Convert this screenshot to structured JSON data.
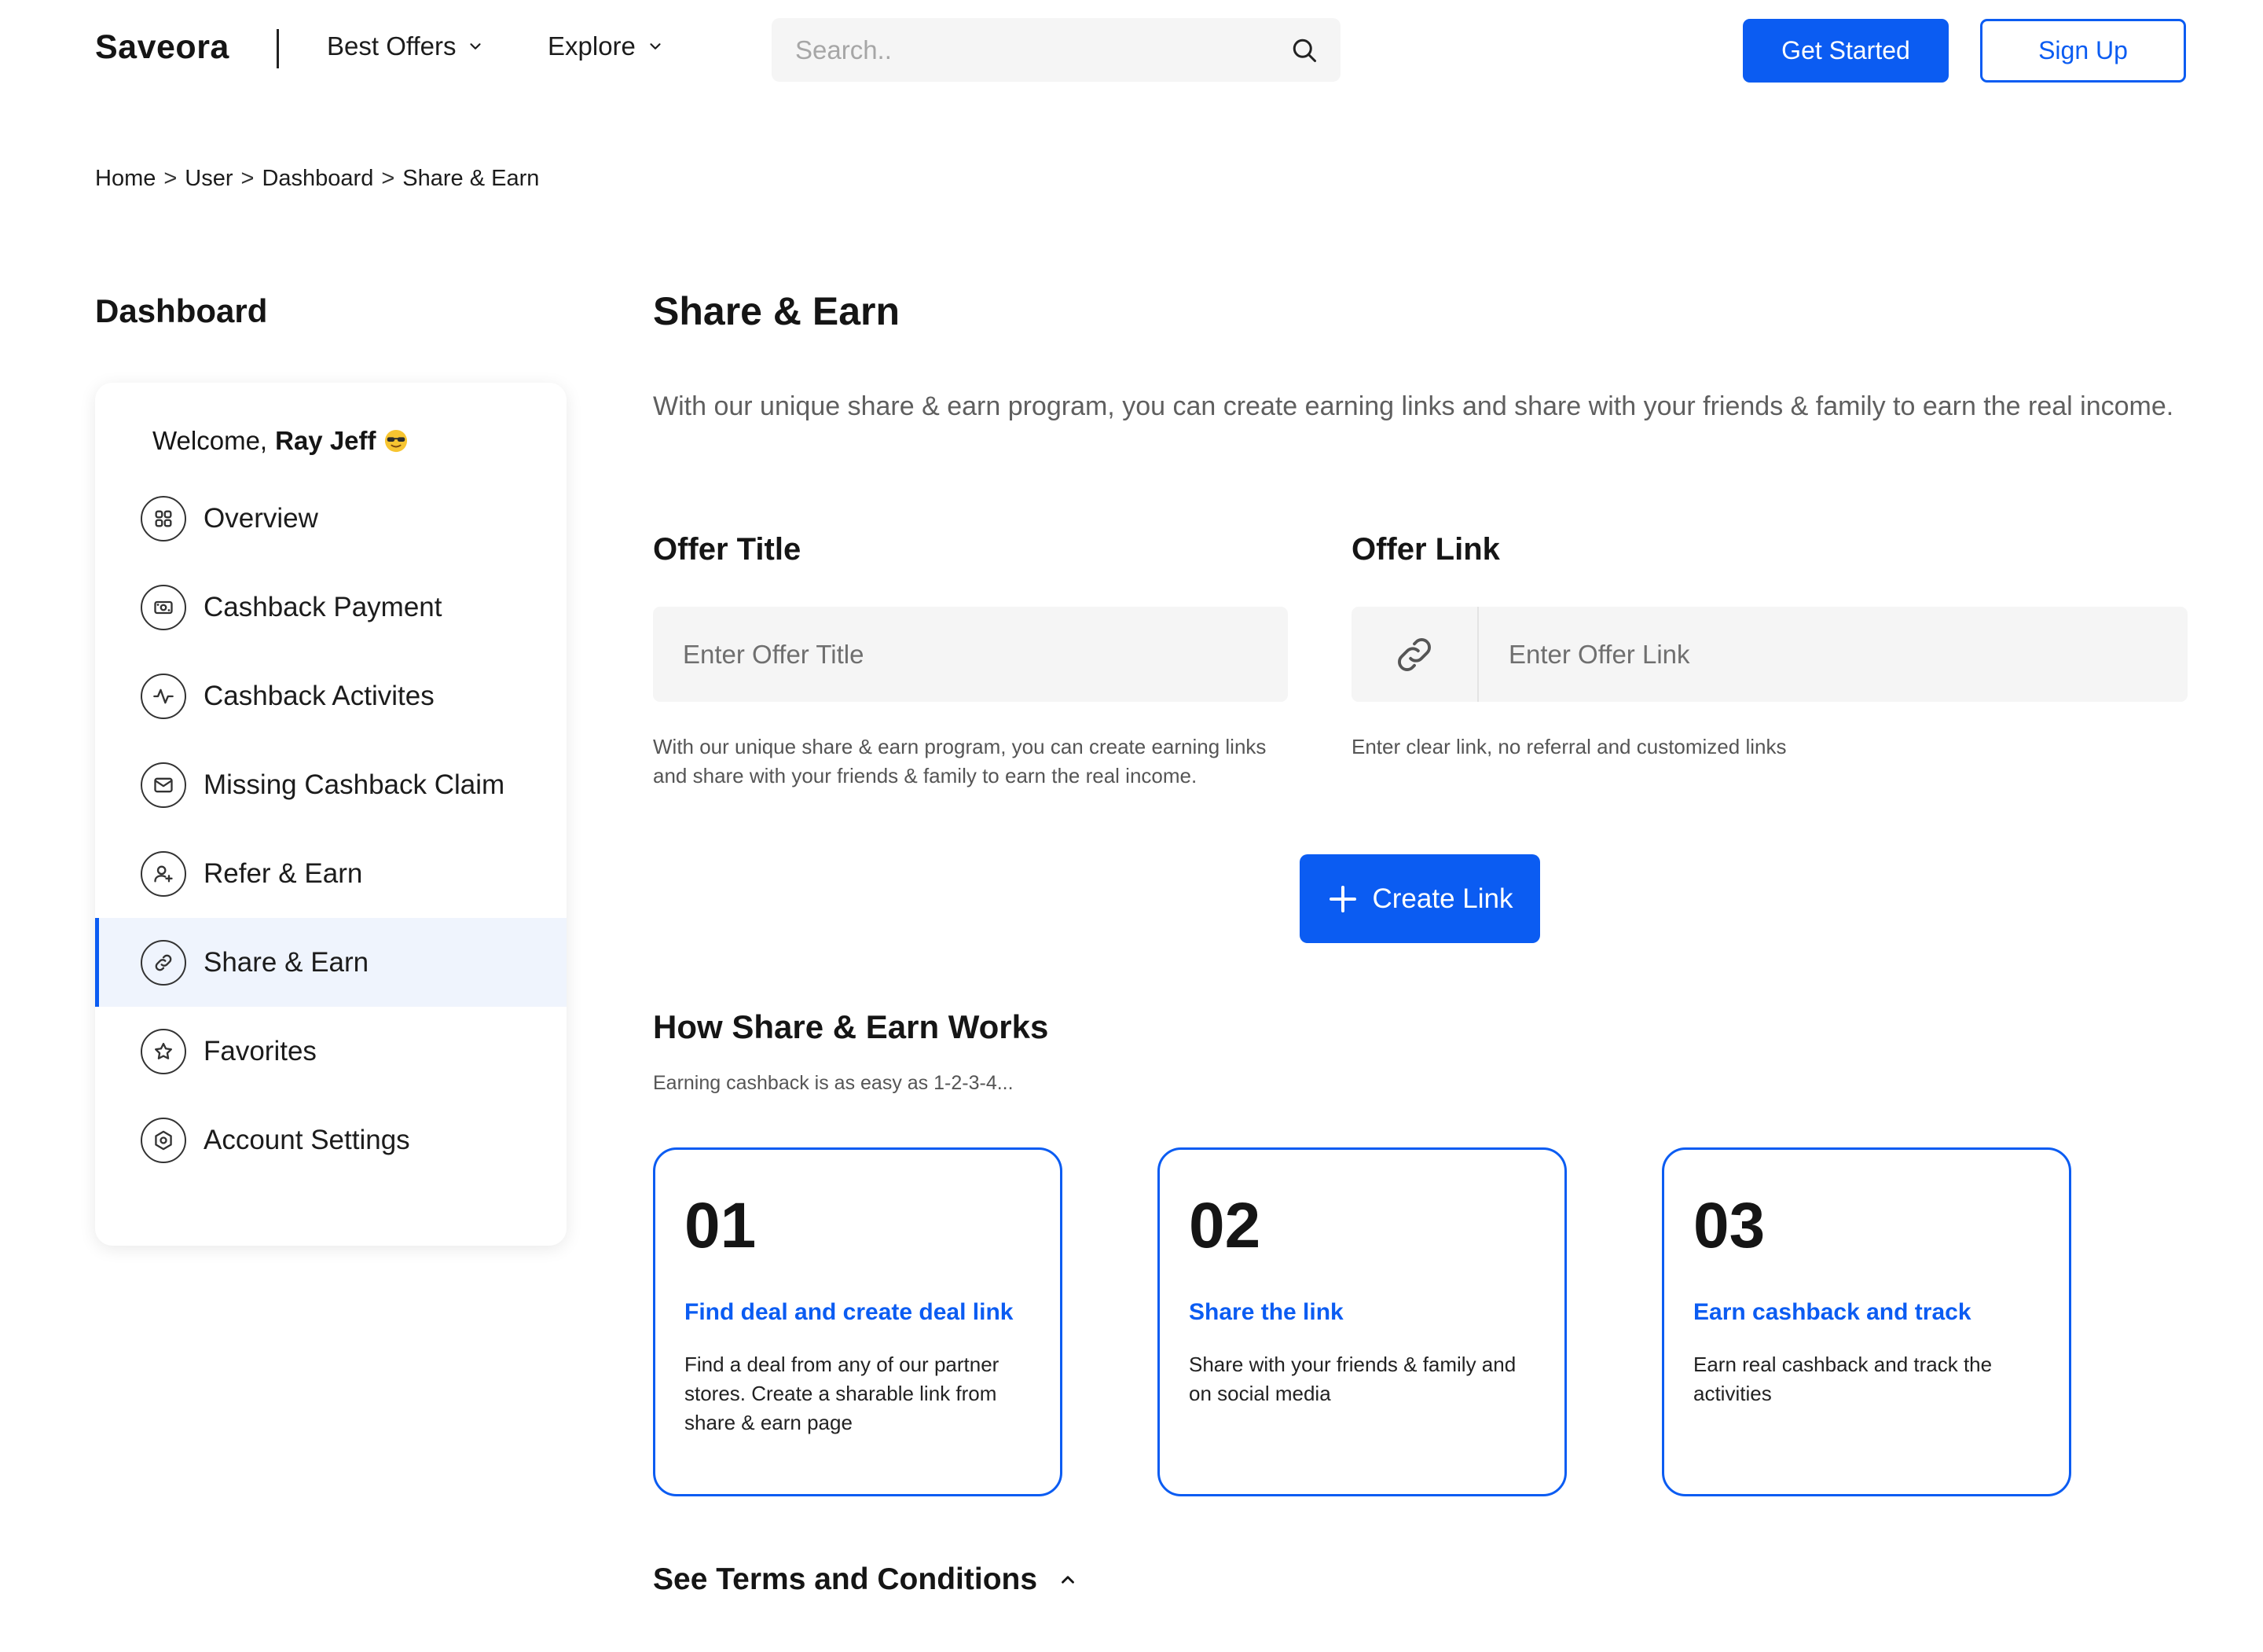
{
  "header": {
    "logo": "Saveora",
    "nav": [
      {
        "label": "Best Offers"
      },
      {
        "label": "Explore"
      }
    ],
    "search_placeholder": "Search..",
    "get_started": "Get Started",
    "sign_up": "Sign Up"
  },
  "breadcrumb": [
    "Home",
    "User",
    "Dashboard",
    "Share & Earn"
  ],
  "breadcrumb_sep": ">",
  "sidebar": {
    "title": "Dashboard",
    "welcome_prefix": "Welcome,",
    "user_name": "Ray Jeff",
    "items": [
      {
        "label": "Overview",
        "icon": "grid-icon"
      },
      {
        "label": "Cashback Payment",
        "icon": "cash-icon"
      },
      {
        "label": "Cashback Activites",
        "icon": "activity-icon"
      },
      {
        "label": "Missing Cashback Claim",
        "icon": "mail-icon"
      },
      {
        "label": "Refer & Earn",
        "icon": "user-plus-icon"
      },
      {
        "label": "Share & Earn",
        "icon": "link-icon"
      },
      {
        "label": "Favorites",
        "icon": "star-icon"
      },
      {
        "label": "Account Settings",
        "icon": "gear-icon"
      }
    ],
    "active_index": 5
  },
  "main": {
    "title": "Share & Earn",
    "intro": "With our unique share & earn program, you can create earning links and share with your friends & family to earn the real income.",
    "offer_title_label": "Offer Title",
    "offer_title_placeholder": "Enter Offer Title",
    "offer_title_help": "With our unique share & earn program, you can create earning links and share with your friends & family to earn the real income.",
    "offer_link_label": "Offer Link",
    "offer_link_placeholder": "Enter Offer Link",
    "offer_link_help": "Enter clear link, no referral and customized links",
    "create_button": "Create Link",
    "how_title": "How Share & Earn Works",
    "how_subtitle": "Earning cashback is as easy as 1-2-3-4...",
    "steps": [
      {
        "num": "01",
        "heading": "Find deal and create deal link",
        "text": "Find a deal from any of our partner stores. Create a sharable link from share & earn page"
      },
      {
        "num": "02",
        "heading": "Share the link",
        "text": "Share with your friends & family and on social media"
      },
      {
        "num": "03",
        "heading": "Earn cashback and track",
        "text": "Earn real cashback and track the activities"
      }
    ],
    "terms": "See Terms and Conditions"
  },
  "colors": {
    "accent": "#0b5cf2",
    "active_bg": "#eff4fd",
    "input_bg": "#f5f5f5"
  }
}
